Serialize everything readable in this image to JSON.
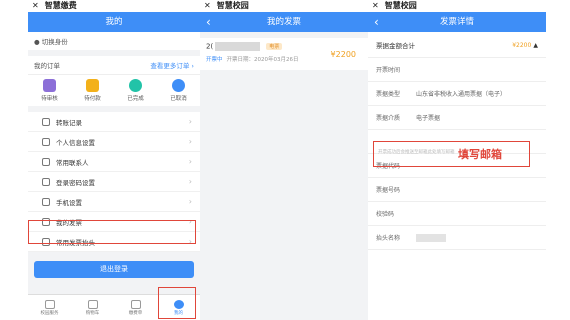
{
  "p1": {
    "app_title": "智慧缴费",
    "nav_title": "我的",
    "switch_identity": "切换身份",
    "orders_label": "我的订单",
    "orders_more": "查看更多订单 ›",
    "orders": [
      {
        "label": "待审核",
        "color": "#8c6fd8"
      },
      {
        "label": "待付款",
        "color": "#f3b11a"
      },
      {
        "label": "已完成",
        "color": "#22c3a8"
      },
      {
        "label": "已取消",
        "color": "#3e8ef7"
      }
    ],
    "menu": [
      "转账记录",
      "个人信息设置",
      "常用联系人",
      "登录密码设置",
      "手机设置",
      "我的发票",
      "常用发票抬头"
    ],
    "logout": "退出登录",
    "tabs": [
      "校园服务",
      "购物车",
      "缴费单",
      "我的"
    ]
  },
  "p2": {
    "app_title": "智慧校园",
    "nav_title": "我的发票",
    "inv_prefix": "2(",
    "badge": "电票",
    "amount": "¥2200",
    "status": "开票中",
    "date": "开票日期：2020年03月26日"
  },
  "p3": {
    "app_title": "智慧校园",
    "nav_title": "发票详情",
    "total_label": "票据金额合计",
    "total_amount": "¥2200",
    "rows": [
      {
        "label": "开票时间",
        "value": ""
      },
      {
        "label": "票据类型",
        "value": "山东省非税收入通用票据（电子）"
      },
      {
        "label": "票据介质",
        "value": "电子票据"
      }
    ],
    "rows2": [
      {
        "label": "票据代码",
        "value": ""
      },
      {
        "label": "票据号码",
        "value": ""
      },
      {
        "label": "校验码",
        "value": ""
      },
      {
        "label": "抬头名称",
        "value": ""
      }
    ],
    "email_placeholder": "开票成功后会推送至邮箱此处填写邮箱",
    "email_hint": "填写邮箱"
  },
  "colors": {
    "accent": "#3e8ef7",
    "highlight": "#e0463a",
    "amount": "#f0a020"
  }
}
